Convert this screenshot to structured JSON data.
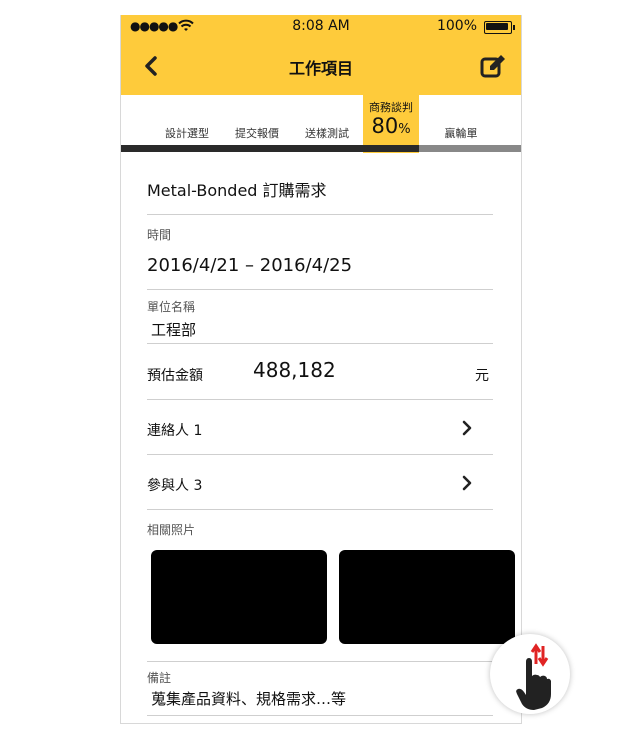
{
  "status_bar": {
    "signal": "●●●●●",
    "time": "8:08 AM",
    "battery": "100%"
  },
  "header": {
    "title": "工作項目"
  },
  "tabs": [
    {
      "label": "設計選型"
    },
    {
      "label": "提交報價"
    },
    {
      "label": "送樣測試"
    },
    {
      "label": "商務談判",
      "percent": "80",
      "percent_sign": "%"
    },
    {
      "label": "贏輪單"
    }
  ],
  "progress": {
    "percent": 80
  },
  "request": {
    "title": "Metal-Bonded 訂購需求"
  },
  "time": {
    "label": "時間",
    "range": "2016/4/21  –  2016/4/25"
  },
  "unit": {
    "label": "單位名稱",
    "value": "工程部"
  },
  "amount": {
    "label": "預估金額",
    "value": "488,182",
    "unit": "元"
  },
  "contacts": {
    "label": "連絡人 1"
  },
  "participants": {
    "label": "參與人 3"
  },
  "photos": {
    "label": "相關照片",
    "count": 2
  },
  "notes": {
    "label": "備註",
    "value": "蒐集產品資料、規格需求…等"
  },
  "colors": {
    "accent": "#fecb3b",
    "dark_bar": "#2a2a2a",
    "light_bar": "#888888",
    "scroll_arrow": "#e02424"
  },
  "icons": [
    "signal-icon",
    "wifi-icon",
    "battery-icon",
    "back-chevron-icon",
    "edit-icon",
    "chevron-right-icon",
    "scroll-gesture-icon"
  ]
}
